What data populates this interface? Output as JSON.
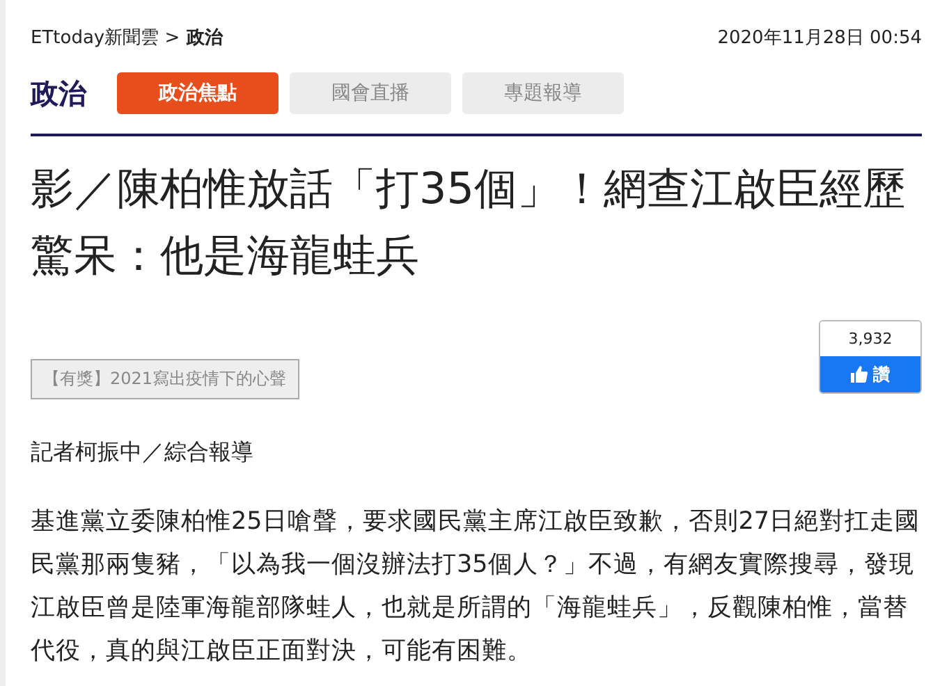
{
  "breadcrumb": {
    "site": "ETtoday新聞雲 >",
    "section": "政治"
  },
  "date": "2020年11月28日 00:54",
  "category": "政治",
  "tabs": [
    {
      "label": "政治焦點",
      "selected": true
    },
    {
      "label": "國會直播",
      "selected": false
    },
    {
      "label": "專題報導",
      "selected": false
    }
  ],
  "headline": "影／陳柏惟放話「打35個」！網查江啟臣經歷驚呆：他是海龍蛙兵",
  "promo": "【有獎】2021寫出疫情下的心聲",
  "like": {
    "count": "3,932",
    "label": "讚"
  },
  "byline": "記者柯振中／綜合報導",
  "paragraph": "基進黨立委陳柏惟25日嗆聲，要求國民黨主席江啟臣致歉，否則27日絕對扛走國民黨那兩隻豬，「以為我一個沒辦法打35個人？」不過，有網友實際搜尋，發現江啟臣曾是陸軍海龍部隊蛙人，也就是所謂的「海龍蛙兵」，反觀陳柏惟，當替代役，真的與江啟臣正面對決，可能有困難。"
}
